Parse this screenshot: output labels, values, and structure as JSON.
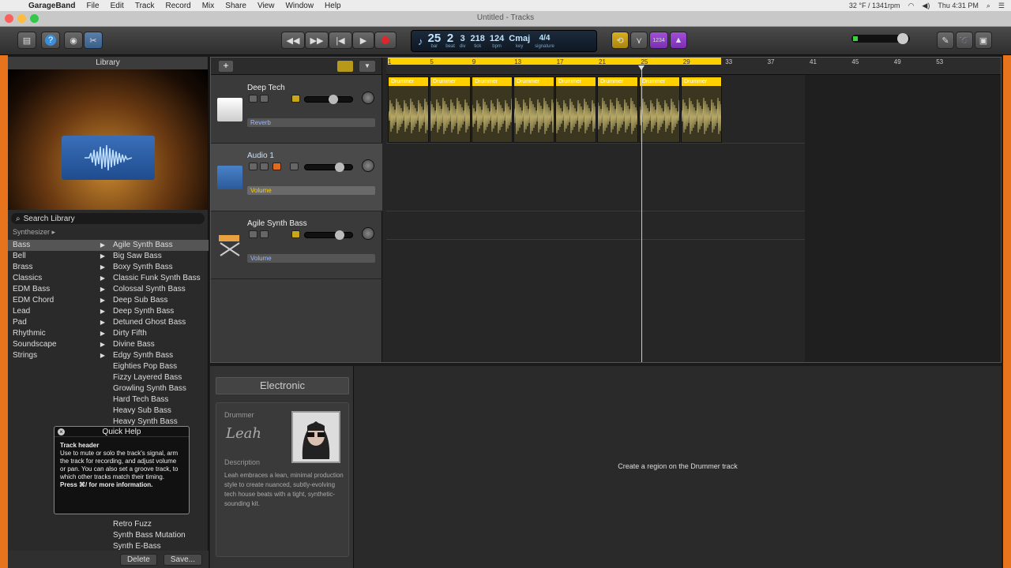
{
  "menubar": {
    "app_name": "GarageBand",
    "items": [
      "File",
      "Edit",
      "Track",
      "Record",
      "Mix",
      "Share",
      "View",
      "Window",
      "Help"
    ],
    "status": "32 °F / 1341rpm",
    "clock": "Thu 4:31 PM"
  },
  "window": {
    "title": "Untitled - Tracks"
  },
  "lcd": {
    "bar": "25",
    "bar_label": "bar",
    "beat": "2",
    "beat_label": "beat",
    "div": "3",
    "div_label": "div",
    "tick": "218",
    "tick_label": "tick",
    "bpm": "124",
    "bpm_label": "bpm",
    "key": "Cmaj",
    "key_label": "key",
    "signature": "4/4",
    "signature_label": "signature"
  },
  "toolbar": {
    "count_in": "1234"
  },
  "library": {
    "title": "Library",
    "search_placeholder": "Search Library",
    "breadcrumb": "Synthesizer",
    "categories": [
      "Bass",
      "Bell",
      "Brass",
      "Classics",
      "EDM Bass",
      "EDM Chord",
      "Lead",
      "Pad",
      "Rhythmic",
      "Soundscape",
      "Strings"
    ],
    "patches": [
      "Agile Synth Bass",
      "Big Saw Bass",
      "Boxy Synth Bass",
      "Classic Funk Synth Bass",
      "Colossal Synth Bass",
      "Deep Sub Bass",
      "Deep Synth Bass",
      "Detuned Ghost Bass",
      "Dirty Fifth",
      "Divine Bass",
      "Edgy Synth Bass",
      "Eighties Pop Bass",
      "Fizzy Layered Bass",
      "Growling Synth Bass",
      "Hard Tech Bass",
      "Heavy Sub Bass",
      "Heavy Synth Bass"
    ],
    "patches_bottom": [
      "Retro Fuzz",
      "Synth Bass Mutation",
      "Synth E-Bass"
    ],
    "delete_label": "Delete",
    "save_label": "Save..."
  },
  "quick_help": {
    "title": "Quick Help",
    "heading": "Track header",
    "body": "Use to mute or solo the track's signal, arm the track for recording, and adjust volume or pan. You can also set a groove track, to which other tracks match their timing.",
    "hint": "Press ⌘/ for more information."
  },
  "tracks": [
    {
      "name": "Deep Tech",
      "param": "Reverb"
    },
    {
      "name": "Audio 1",
      "param": "Volume"
    },
    {
      "name": "Agile Synth Bass",
      "param": "Volume"
    }
  ],
  "ruler": {
    "marks": [
      "1",
      "5",
      "9",
      "13",
      "17",
      "21",
      "25",
      "29",
      "33",
      "37",
      "41",
      "45",
      "49",
      "53"
    ]
  },
  "region_label": "Drummer",
  "editor": {
    "genre": "Electronic",
    "drummer_label": "Drummer",
    "drummer_signature": "Leah",
    "description_label": "Description",
    "description": "Leah embraces a lean, minimal production style to create nuanced, subtly-evolving tech house beats with a tight, synthetic-sounding kit.",
    "message": "Create a region on the Drummer track"
  },
  "colors": {
    "accent": "#ffd000",
    "record": "#e0262b",
    "library_border": "#e8731d"
  }
}
